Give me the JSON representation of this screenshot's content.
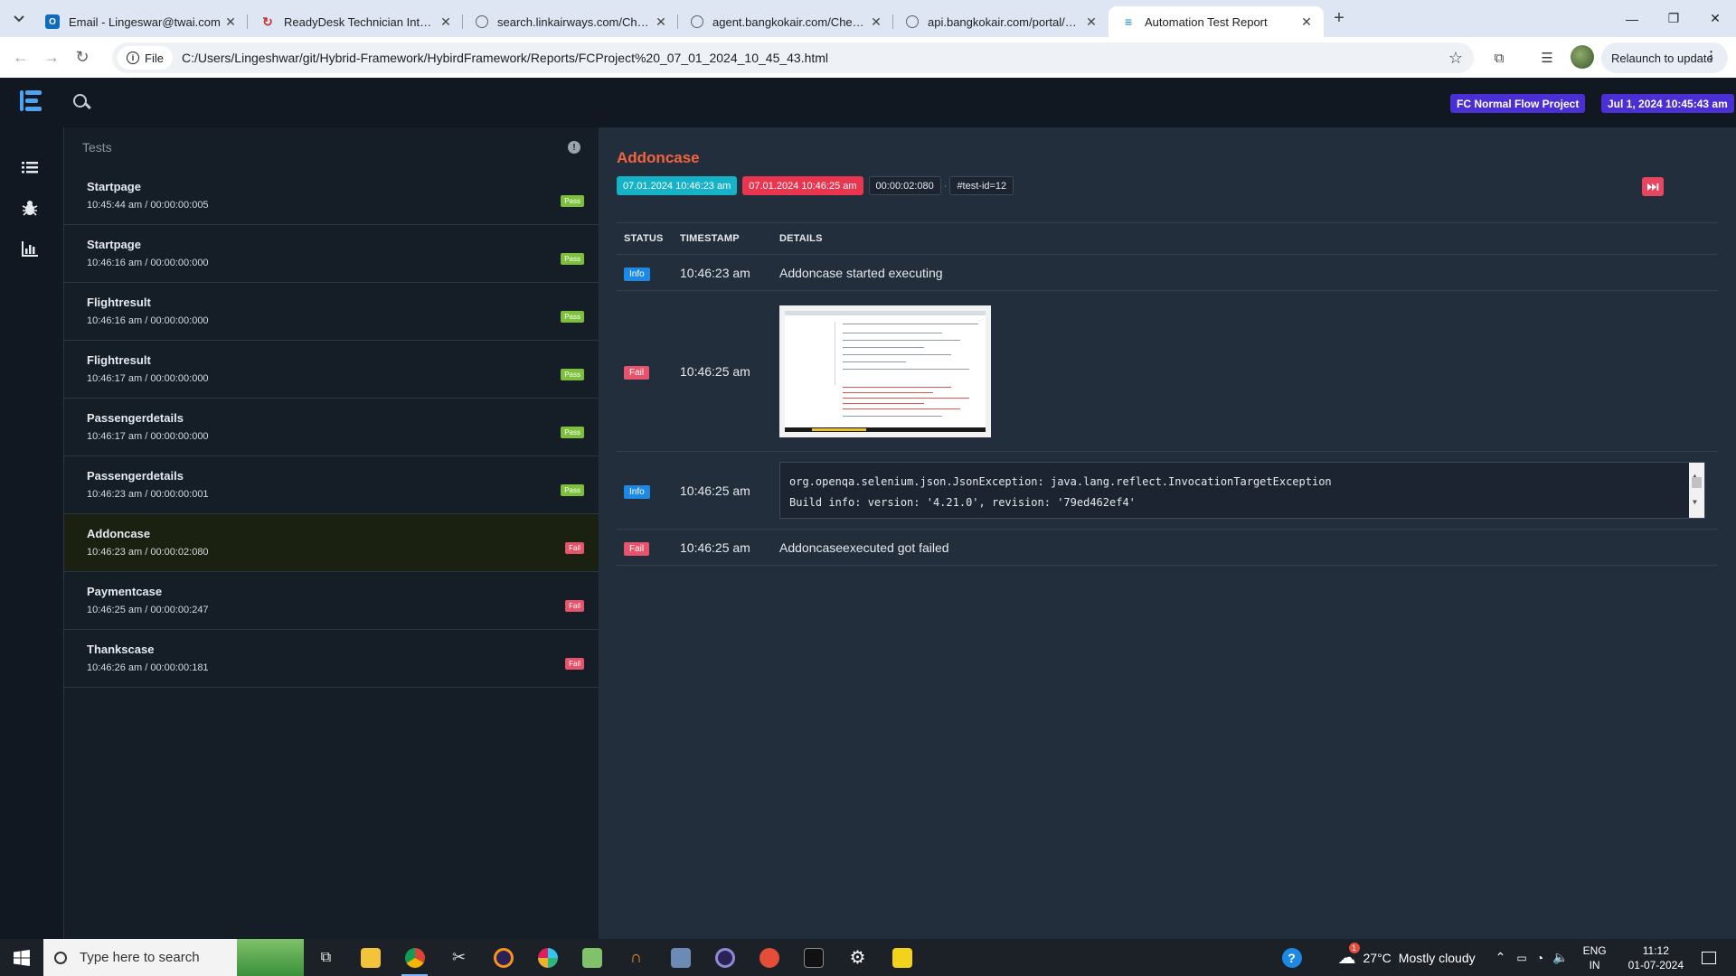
{
  "browser": {
    "tabs": [
      {
        "title": "Email - Lingeswar@twai.com",
        "icon": "outlook-icon",
        "color": "#0f6cbd"
      },
      {
        "title": "ReadyDesk Technician Interface",
        "icon": "readydesk-icon",
        "color": "#c0392b"
      },
      {
        "title": "search.linkairways.com/CheckB",
        "icon": "globe-icon",
        "color": "#5f6368"
      },
      {
        "title": "agent.bangkokair.com/CheckBo",
        "icon": "globe-icon",
        "color": "#5f6368"
      },
      {
        "title": "api.bangkokair.com/portal/Che",
        "icon": "globe-icon",
        "color": "#5f6368"
      },
      {
        "title": "Automation Test Report",
        "icon": "extent-report-icon",
        "color": "#1e88e5",
        "active": true
      }
    ],
    "site_chip": "File",
    "url": "C:/Users/Lingeshwar/git/Hybrid-Framework/HybirdFramework/Reports/FCProject%20_07_01_2024_10_45_43.html",
    "relaunch_label": "Relaunch to update"
  },
  "report": {
    "project_badge": "FC Normal Flow Project",
    "date_badge": "Jul 1, 2024 10:45:43 am",
    "panel_title": "Tests",
    "tests": [
      {
        "name": "Startpage",
        "meta": "10:45:44 am / 00:00:00:005",
        "status": "Pass"
      },
      {
        "name": "Startpage",
        "meta": "10:46:16 am / 00:00:00:000",
        "status": "Pass"
      },
      {
        "name": "Flightresult",
        "meta": "10:46:16 am / 00:00:00:000",
        "status": "Pass"
      },
      {
        "name": "Flightresult",
        "meta": "10:46:17 am / 00:00:00:000",
        "status": "Pass"
      },
      {
        "name": "Passengerdetails",
        "meta": "10:46:17 am / 00:00:00:000",
        "status": "Pass"
      },
      {
        "name": "Passengerdetails",
        "meta": "10:46:23 am / 00:00:00:001",
        "status": "Pass"
      },
      {
        "name": "Addoncase",
        "meta": "10:46:23 am / 00:00:02:080",
        "status": "Fail",
        "active": true
      },
      {
        "name": "Paymentcase",
        "meta": "10:46:25 am / 00:00:00:247",
        "status": "Fail"
      },
      {
        "name": "Thankscase",
        "meta": "10:46:26 am / 00:00:00:181",
        "status": "Fail"
      }
    ],
    "detail": {
      "title": "Addoncase",
      "start": "07.01.2024 10:46:23 am",
      "end": "07.01.2024 10:46:25 am",
      "duration": "00:00:02:080",
      "test_id": "#test-id=12",
      "columns": {
        "status": "STATUS",
        "timestamp": "TIMESTAMP",
        "details": "DETAILS"
      },
      "logs": [
        {
          "status": "Info",
          "time": "10:46:23 am",
          "text": "Addoncase started executing"
        },
        {
          "status": "Fail",
          "time": "10:46:25 am",
          "type": "screenshot"
        },
        {
          "status": "Info",
          "time": "10:46:25 am",
          "type": "code",
          "code_line1": "org.openqa.selenium.json.JsonException: java.lang.reflect.InvocationTargetException",
          "code_line2": "Build info: version: '4.21.0', revision: '79ed462ef4'"
        },
        {
          "status": "Fail",
          "time": "10:46:25 am",
          "text": "Addoncaseexecuted got failed"
        }
      ]
    }
  },
  "taskbar": {
    "search_placeholder": "Type here to search",
    "weather_temp": "27°C",
    "weather_text": "Mostly cloudy",
    "weather_alert": "1",
    "lang_top": "ENG",
    "lang_bottom": "IN",
    "time": "11:12",
    "date": "01-07-2024"
  },
  "colors": {
    "accent_title": "#f26440",
    "pass": "#7dbf3c",
    "fail": "#e6546b",
    "info": "#1e88e5",
    "badge": "#4a2fd4"
  }
}
